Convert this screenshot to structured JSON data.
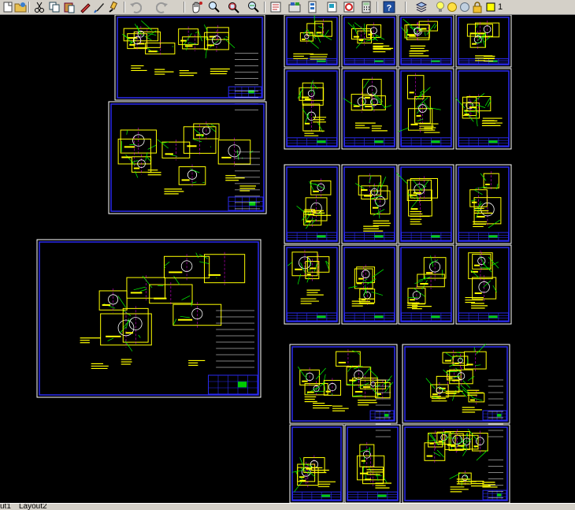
{
  "toolbar": {
    "icons": [
      "new-file-icon",
      "open-icon",
      "cut-icon",
      "copy-icon",
      "paste-icon",
      "match-properties-icon",
      "brush-icon",
      "undo-icon",
      "redo-icon",
      "pan-icon",
      "zoom-realtime-icon",
      "zoom-window-icon",
      "zoom-previous-icon",
      "properties-icon",
      "design-center-icon",
      "tool-palettes-icon",
      "sheet-set-icon",
      "markup-icon",
      "calculator-icon",
      "help-icon",
      "layer-manager-icon",
      "layer-on-icon",
      "layer-freeze-icon",
      "layer-lock-icon",
      "layer-color-icon"
    ],
    "current_layer": "1"
  },
  "layout_tabs": [
    "ut1",
    "Layout2"
  ],
  "colors": {
    "toolbar_bg": "#d4d0c8",
    "canvas_bg": "#000000",
    "sheet_border": "#2a2af0",
    "drawing_primary": "#ffff00",
    "drawing_secondary": "#ffffff",
    "drawing_accent": "#00ff00",
    "drawing_highlight": "#ff00ff"
  }
}
